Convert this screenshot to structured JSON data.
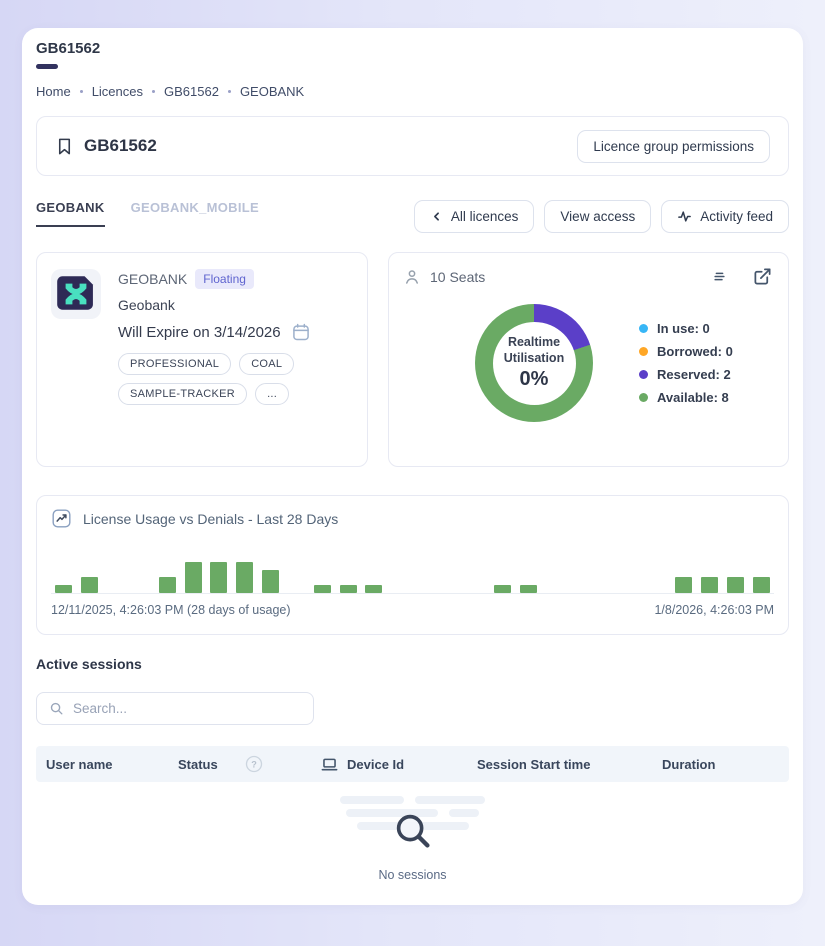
{
  "page": {
    "title": "GB61562",
    "breadcrumb": [
      "Home",
      "Licences",
      "GB61562",
      "GEOBANK"
    ]
  },
  "licence_header": {
    "title": "GB61562",
    "permissions_button": "Licence group permissions"
  },
  "tabs": [
    {
      "label": "GEOBANK",
      "active": true
    },
    {
      "label": "GEOBANK_MOBILE",
      "active": false
    }
  ],
  "toolbar": {
    "all_licences": "All licences",
    "view_access": "View access",
    "activity_feed": "Activity feed"
  },
  "product_card": {
    "name": "GEOBANK",
    "badge": "Floating",
    "product": "Geobank",
    "expiry": "Will Expire on 3/14/2026",
    "tags": [
      "PROFESSIONAL",
      "COAL",
      "SAMPLE-TRACKER",
      "..."
    ]
  },
  "seats_card": {
    "title": "10 Seats",
    "center_line1": "Realtime",
    "center_line2": "Utilisation",
    "center_value": "0%",
    "legend": [
      {
        "label": "In use: 0",
        "color": "#38b6f6"
      },
      {
        "label": "Borrowed: 0",
        "color": "#ffa726"
      },
      {
        "label": "Reserved: 2",
        "color": "#5b3fc8"
      },
      {
        "label": "Available: 8",
        "color": "#6aaa64"
      }
    ],
    "chart_data": {
      "type": "pie",
      "title": "Realtime Utilisation",
      "center_text": "0%",
      "total_seats": 10,
      "series": [
        {
          "name": "In use",
          "value": 0,
          "color": "#38b6f6"
        },
        {
          "name": "Borrowed",
          "value": 0,
          "color": "#ffa726"
        },
        {
          "name": "Reserved",
          "value": 2,
          "color": "#5b3fc8"
        },
        {
          "name": "Available",
          "value": 8,
          "color": "#6aaa64"
        }
      ]
    }
  },
  "usage_card": {
    "title": "License Usage vs Denials - Last 28 Days",
    "footer_left": "12/11/2025, 4:26:03 PM (28 days of usage)",
    "footer_right": "1/8/2026, 4:26:03 PM",
    "chart_data": {
      "type": "bar",
      "days": 28,
      "x_start": "12/11/2025, 4:26:03 PM",
      "x_end": "1/8/2026, 4:26:03 PM",
      "bar_color": "#6aaa64",
      "ymax": 4,
      "values": [
        1,
        2,
        0,
        0,
        2,
        4,
        4,
        4,
        3,
        0,
        1,
        1,
        1,
        0,
        0,
        0,
        0,
        1,
        1,
        0,
        0,
        0,
        0,
        0,
        2,
        2,
        2,
        2
      ]
    }
  },
  "sessions": {
    "heading": "Active sessions",
    "search_placeholder": "Search...",
    "columns": [
      "User name",
      "Status",
      "Device Id",
      "Session Start time",
      "Duration"
    ],
    "empty_text": "No sessions"
  },
  "colors": {
    "accent_green": "#6aaa64",
    "accent_purple": "#5b3fc8",
    "accent_blue": "#38b6f6",
    "accent_orange": "#ffa726",
    "brand_navy": "#2e2a56",
    "brand_teal": "#49e0c0",
    "table_header_bg": "#f1f5fa"
  }
}
